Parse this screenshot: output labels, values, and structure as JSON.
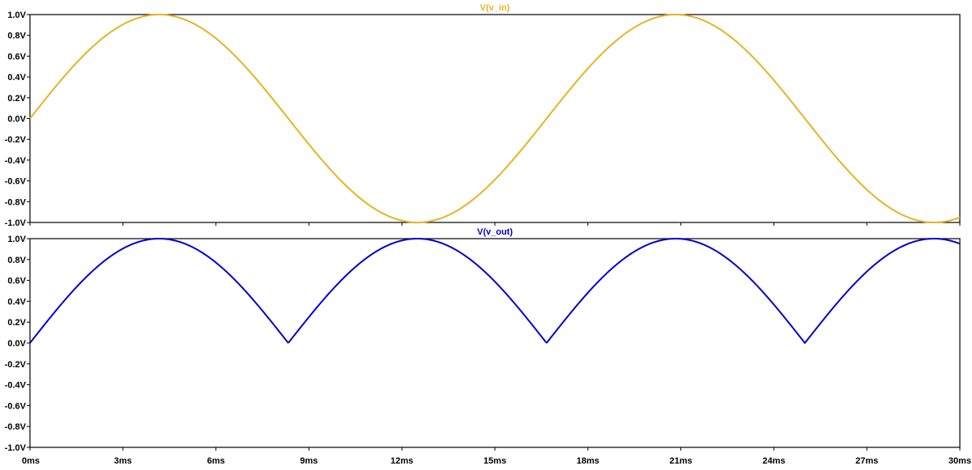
{
  "chart_data": [
    {
      "type": "line",
      "title": "V(v_in)",
      "color": "#e6b422",
      "x_unit": "ms",
      "y_unit": "V",
      "xlim": [
        0,
        30
      ],
      "ylim": [
        -1.0,
        1.0
      ],
      "x_ticks": [
        "0ms",
        "3ms",
        "6ms",
        "9ms",
        "12ms",
        "15ms",
        "18ms",
        "21ms",
        "24ms",
        "27ms",
        "30ms"
      ],
      "y_ticks": [
        "1.0V",
        "0.8V",
        "0.6V",
        "0.4V",
        "0.2V",
        "0.0V",
        "-0.2V",
        "-0.4V",
        "-0.6V",
        "-0.8V",
        "-1.0V"
      ],
      "series": [
        {
          "name": "V(v_in)",
          "function": "sin",
          "frequency_hz": 60,
          "amplitude": 1.0
        }
      ],
      "grid": false
    },
    {
      "type": "line",
      "title": "V(v_out)",
      "color": "#0000cc",
      "x_unit": "ms",
      "y_unit": "V",
      "xlim": [
        0,
        30
      ],
      "ylim": [
        -1.0,
        1.0
      ],
      "x_ticks": [
        "0ms",
        "3ms",
        "6ms",
        "9ms",
        "12ms",
        "15ms",
        "18ms",
        "21ms",
        "24ms",
        "27ms",
        "30ms"
      ],
      "y_ticks": [
        "1.0V",
        "0.8V",
        "0.6V",
        "0.4V",
        "0.2V",
        "0.0V",
        "-0.2V",
        "-0.4V",
        "-0.6V",
        "-0.8V",
        "-1.0V"
      ],
      "series": [
        {
          "name": "V(v_out)",
          "function": "abs(sin)",
          "frequency_hz": 60,
          "amplitude": 1.0
        }
      ],
      "grid": false
    }
  ]
}
